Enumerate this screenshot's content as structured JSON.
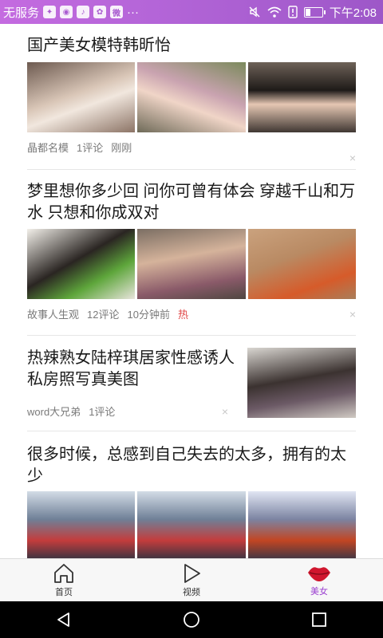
{
  "status_bar": {
    "carrier": "无服务",
    "time": "下午2:08",
    "more": "···",
    "battery_level": 0.3,
    "app_icons": [
      "game-icon",
      "browser-icon",
      "tiktok-icon",
      "baidu-icon",
      "weibo-icon"
    ]
  },
  "feed": {
    "articles": [
      {
        "title": "国产美女模特韩昕怡",
        "source": "晶都名模",
        "comments": "1评论",
        "time": "刚刚",
        "hot": ""
      },
      {
        "title": "梦里想你多少回 问你可曾有体会 穿越千山和万水 只想和你成双对",
        "source": "故事人生观",
        "comments": "12评论",
        "time": "10分钟前",
        "hot": "热"
      },
      {
        "title": "热辣熟女陆梓琪居家性感诱人私房照写真美图",
        "source": "word大兄弟",
        "comments": "1评论",
        "time": "",
        "hot": ""
      },
      {
        "title": "很多时候，总感到自己失去的太多，拥有的太少",
        "source": "",
        "comments": "",
        "time": "",
        "hot": ""
      }
    ],
    "close_symbol": "×"
  },
  "bottom_nav": {
    "items": [
      {
        "label": "首页",
        "icon": "home-icon"
      },
      {
        "label": "视频",
        "icon": "play-icon"
      },
      {
        "label": "美女",
        "icon": "lips-icon",
        "active": true
      }
    ],
    "accent": "#9b3fd0"
  }
}
